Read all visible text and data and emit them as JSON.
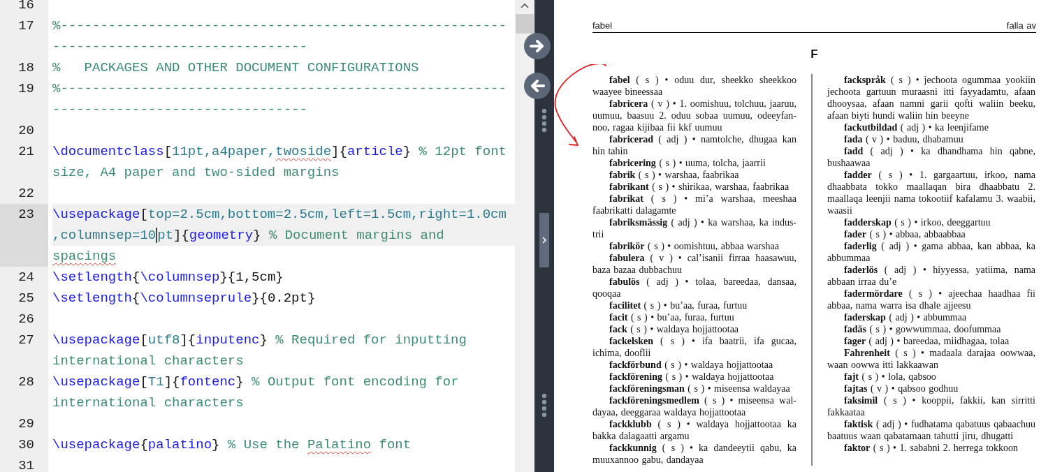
{
  "editor": {
    "lines": [
      {
        "number": "16",
        "current": false
      },
      {
        "number": "17",
        "current": false,
        "tokens": [
          {
            "kind": "comment",
            "text": "%--------------------------------------------------------"
          },
          {
            "kind": "break"
          },
          {
            "kind": "comment",
            "text": "--------------------------------"
          }
        ]
      },
      {
        "number": "18",
        "current": false,
        "tokens": [
          {
            "kind": "comment",
            "text": "%   PACKAGES AND OTHER DOCUMENT CONFIGURATIONS"
          }
        ]
      },
      {
        "number": "19",
        "current": false,
        "tokens": [
          {
            "kind": "comment",
            "text": "%--------------------------------------------------------"
          },
          {
            "kind": "break"
          },
          {
            "kind": "comment",
            "text": "--------------------------------"
          }
        ]
      },
      {
        "number": "20",
        "current": false
      },
      {
        "number": "21",
        "current": false,
        "tokens": [
          {
            "kind": "command",
            "text": "\\documentclass"
          },
          {
            "kind": "plain",
            "text": "["
          },
          {
            "kind": "option",
            "text": "11pt,a4paper,"
          },
          {
            "kind": "option",
            "text": "twoside",
            "misspelled": true
          },
          {
            "kind": "plain",
            "text": "]{"
          },
          {
            "kind": "command",
            "text": "article"
          },
          {
            "kind": "plain",
            "text": "}"
          },
          {
            "kind": "comment",
            "text": " % 12pt font"
          },
          {
            "kind": "break"
          },
          {
            "kind": "comment",
            "text": "size, A4 paper and two-sided margins"
          }
        ]
      },
      {
        "number": "22",
        "current": false
      },
      {
        "number": "23",
        "current": true,
        "tokens": [
          {
            "kind": "command",
            "text": "\\usepackage"
          },
          {
            "kind": "plain",
            "text": "["
          },
          {
            "kind": "option",
            "text": "top=2.5cm,bottom=2.5cm,left=1.5cm,right=1.0cm"
          },
          {
            "kind": "break"
          },
          {
            "kind": "option",
            "text": ",columnsep=10",
            "cursor": true
          },
          {
            "kind": "option",
            "text": "pt"
          },
          {
            "kind": "plain",
            "text": "]{"
          },
          {
            "kind": "command",
            "text": "geometry"
          },
          {
            "kind": "plain",
            "text": "}"
          },
          {
            "kind": "comment",
            "text": " % Document margins and"
          },
          {
            "kind": "break"
          },
          {
            "kind": "comment",
            "text": "spacings",
            "misspelled": true
          }
        ]
      },
      {
        "number": "24",
        "current": false,
        "tokens": [
          {
            "kind": "command",
            "text": "\\setlength"
          },
          {
            "kind": "plain",
            "text": "{"
          },
          {
            "kind": "command",
            "text": "\\columnsep"
          },
          {
            "kind": "plain",
            "text": "}{1,5cm}"
          }
        ]
      },
      {
        "number": "25",
        "current": false,
        "tokens": [
          {
            "kind": "command",
            "text": "\\setlength"
          },
          {
            "kind": "plain",
            "text": "{"
          },
          {
            "kind": "command",
            "text": "\\columnseprule"
          },
          {
            "kind": "plain",
            "text": "}{0.2pt}"
          }
        ]
      },
      {
        "number": "26",
        "current": false
      },
      {
        "number": "27",
        "current": false,
        "tokens": [
          {
            "kind": "command",
            "text": "\\usepackage"
          },
          {
            "kind": "plain",
            "text": "["
          },
          {
            "kind": "option",
            "text": "utf8"
          },
          {
            "kind": "plain",
            "text": "]{"
          },
          {
            "kind": "command",
            "text": "inputenc"
          },
          {
            "kind": "plain",
            "text": "}"
          },
          {
            "kind": "comment",
            "text": " % Required for inputting"
          },
          {
            "kind": "break"
          },
          {
            "kind": "comment",
            "text": "international characters"
          }
        ]
      },
      {
        "number": "28",
        "current": false,
        "tokens": [
          {
            "kind": "command",
            "text": "\\usepackage"
          },
          {
            "kind": "plain",
            "text": "["
          },
          {
            "kind": "option",
            "text": "T1"
          },
          {
            "kind": "plain",
            "text": "]{"
          },
          {
            "kind": "command",
            "text": "fontenc"
          },
          {
            "kind": "plain",
            "text": "}"
          },
          {
            "kind": "comment",
            "text": " % Output font encoding for"
          },
          {
            "kind": "break"
          },
          {
            "kind": "comment",
            "text": "international characters"
          }
        ]
      },
      {
        "number": "29",
        "current": false
      },
      {
        "number": "30",
        "current": false,
        "tokens": [
          {
            "kind": "command",
            "text": "\\usepackage"
          },
          {
            "kind": "plain",
            "text": "{"
          },
          {
            "kind": "command",
            "text": "palatino"
          },
          {
            "kind": "plain",
            "text": "}"
          },
          {
            "kind": "comment",
            "text": " % Use the "
          },
          {
            "kind": "comment",
            "text": "Palatino",
            "misspelled": true
          },
          {
            "kind": "comment",
            "text": " font"
          }
        ]
      },
      {
        "number": "31",
        "current": false
      }
    ]
  },
  "pdf": {
    "header_left": "fabel",
    "header_right": "falla av",
    "section_letter": "F",
    "columns": [
      [
        "**fabel** ( s ) • oduu dur, sheekko sheekkoo waayee bineessaa",
        "**fabricera** ( v ) • 1. oomishuu, tolchuu, jaaruu, uumuu, baasuu 2. oduu sobaa uumuu, odeeyfan-noo, ragaa kijibaa fii kkf uumuu",
        "**fabricerad** ( adj ) • namtolche, dhugaa kan hin tahin",
        "**fabricering** ( s ) • uuma, tolcha, jaarrii",
        "**fabrik** ( s ) • warshaa, faabrikaa",
        "**fabrikant** ( s ) • shirikaa, warshaa, faabrikaa",
        "**fabrikat** ( s ) • mi’a warshaa, meeshaa faabrikatti dalagamte",
        "**fabriksmässig** ( adj ) • ka warshaa, ka indus-trii",
        "**fabrikör** ( s ) • oomishtuu, abbaa warshaa",
        "**fabulera** ( v ) • cal’isanii firraa haasawuu, baza bazaa dubbachuu",
        "**fabulös** ( adj ) • tolaa, bareedaa, dansaa, qooqaa",
        "**facilitet** ( s ) • bu’aa, furaa, furtuu",
        "**facit** ( s ) • bu’aa, furaa, furtuu",
        "**fack** ( s ) • waldaya hojjattootaa",
        "**fackelsken** ( s ) • ifa baatrii, ifa gucaa, ichima, dooflii",
        "**fackförbund** ( s ) • waldaya hojjattootaa",
        "**fackförening** ( s ) • waldaya hojjattootaa",
        "**fackföreningsman** ( s ) • miseensa waldayaa",
        "**fackföreningsmedlem** ( s ) • miseensa wal-dayaa, deeggaraa waldaya hojjattootaa",
        "**fackklubb** ( s ) • waldaya hojjattootaa ka bakka dalagaatti argamu",
        "**fackkunnig** ( s ) • ka dandeeytii qabu, ka muuxannoo gabu, dandayaa"
      ],
      [
        "**fackspråk** ( s ) • jechoota ogummaa yookiin jechoota gartuun muraasni itti fayyadamtu, afaan dhooysaa, afaan namni garii qofti waliin beeku, afaan biyti hundi waliin hin beeyne",
        "**fackutbildad** ( adj ) • ka leenjifame",
        "**fada** ( v ) • baduu, dhabamuu",
        "**fadd** ( adj ) • ka dhandhama hin qabne, bushaawaa",
        "**fadder** ( s ) • 1. gargaartuu, irkoo, nama dhaabbata tokko maallaqan bira dhaabbatu 2. maallaqa leenjii nama tokootiif kafalamu 3. waabii, waasii",
        "**fadderskap** ( s ) • irkoo, deeggartuu",
        "**fader** ( s ) • abbaa, abbaabbaa",
        "**faderlig** ( adj ) • gama abbaa, kan abbaa, ka abbummaa",
        "**faderlös** ( adj ) • hiyyessa, yatiima, nama abbaan irraa du’e",
        "**fadermördare** ( s ) • ajeechaa haadhaa fii abbaa, nama warra isa dhale ajjeesu",
        "**faderskap** ( adj ) • abbummaa",
        "**fadäs** ( s ) • gowwummaa, doofummaa",
        "**fager** ( adj ) • bareedaa, miidhagaa, tolaa",
        "**Fahrenheit** ( s ) • madaala darajaa oowwaa, waan oowwa itti lakkaawan",
        "**fajt** ( s ) • lola, qabsoo",
        "**fajtas** ( v ) • qabsoo godhuu",
        "**faksimil** ( s ) • kooppii, fakkii, kan sirritti fakkaataa",
        "**faktisk** ( adj ) • fudhatama qabatuus qabaachuu baatuus waan qabatamaan tahutti jiru, dhugatti",
        "**faktor** ( s ) • 1. sababni 2. herrega tokkoon"
      ]
    ]
  }
}
